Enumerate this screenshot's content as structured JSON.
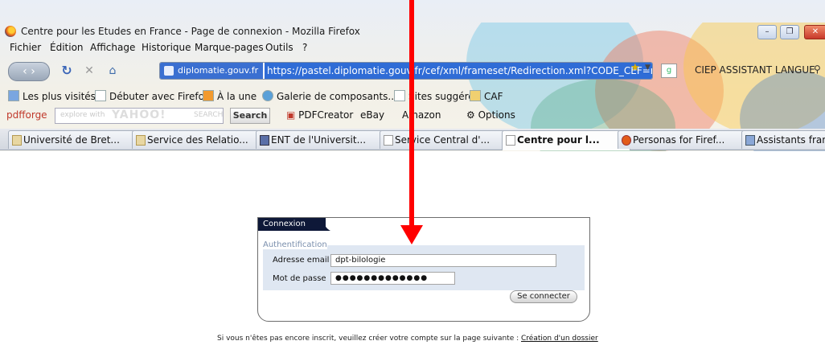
{
  "window": {
    "title": "Centre pour les Etudes en France - Page de connexion - Mozilla Firefox",
    "controls": {
      "minimize": "–",
      "maximize": "❐",
      "close": "✕"
    }
  },
  "menu": [
    "Fichier",
    "Édition",
    "Affichage",
    "Historique",
    "Marque-pages",
    "Outils",
    "?"
  ],
  "navigation": {
    "identity": "diplomatie.gouv.fr",
    "url": "https://pastel.diplomatie.gouv.fr/cef/xml/frameset/Redirection.xml?CODE_CEF=nul",
    "search_text": "CIEP ASSISTANT LANGUE"
  },
  "bookmarks": [
    {
      "label": "Les plus visités",
      "icon": "bookmark-icon"
    },
    {
      "label": "Débuter avec Firefox",
      "icon": "page-icon"
    },
    {
      "label": "À la une",
      "icon": "rss-icon"
    },
    {
      "label": "Galerie de composants...",
      "icon": "globe-icon"
    },
    {
      "label": "Sites suggérés",
      "icon": "page-icon"
    },
    {
      "label": "CAF",
      "icon": "folder-icon"
    }
  ],
  "toolbar2": {
    "brand": "pdfforge",
    "search_placeholder": "explore with",
    "yahoo_logo": "YAHOO!",
    "yahoo_search": "SEARCH",
    "search_button": "Search",
    "items": [
      "PDFCreator",
      "eBay",
      "Amazon",
      "Options"
    ]
  },
  "tabs": [
    {
      "label": "Université de Bret...",
      "active": false
    },
    {
      "label": "Service des Relatio...",
      "active": false
    },
    {
      "label": "ENT de l'Universit...",
      "active": false
    },
    {
      "label": "Service Central d'...",
      "active": false
    },
    {
      "label": "Centre pour l...",
      "active": true
    },
    {
      "label": "Personas for Firef...",
      "active": false
    },
    {
      "label": "Assistants français...",
      "active": false
    }
  ],
  "login": {
    "header": "Connexion",
    "section_legend": "Authentification",
    "email_label": "Adresse email",
    "email_value": "dpt-bilologie",
    "password_label": "Mot de passe",
    "password_value": "●●●●●●●●●●●●●",
    "submit": "Se connecter"
  },
  "footer": {
    "text": "Si vous n'êtes pas encore inscrit, veuillez créer votre compte sur la page suivante : ",
    "link": "Création d'un dossier"
  },
  "annotation": {
    "arrow_color": "#ff0000"
  }
}
